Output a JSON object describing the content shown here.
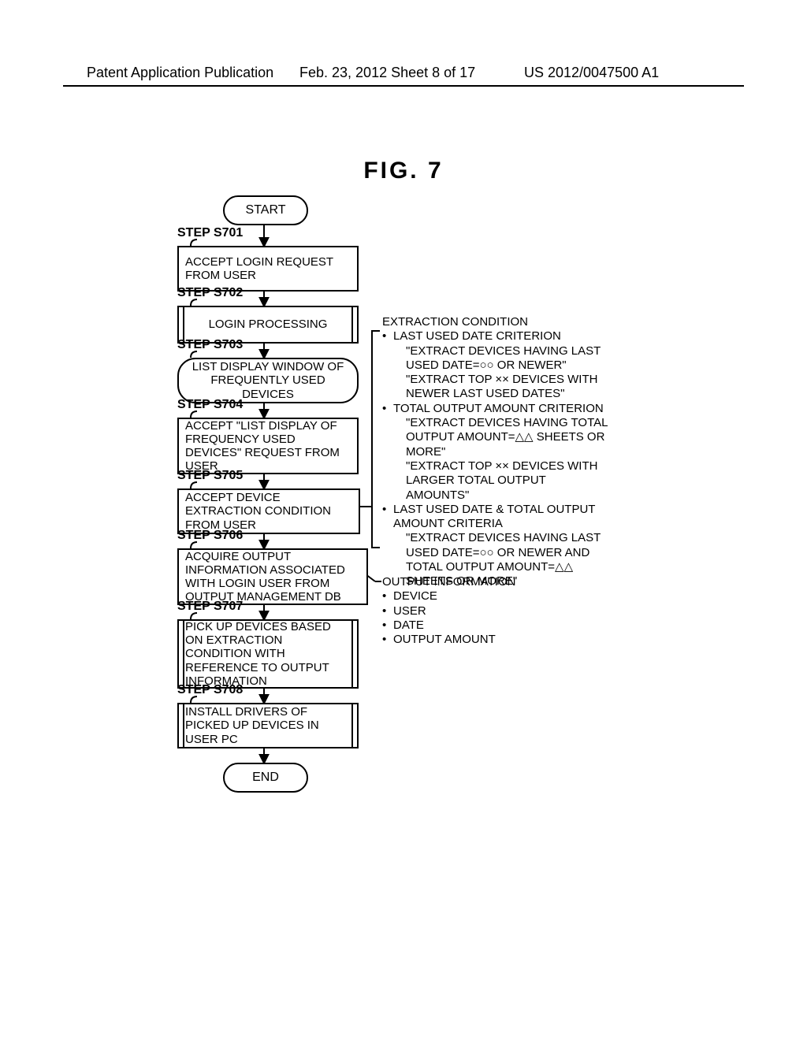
{
  "header": {
    "left": "Patent Application Publication",
    "mid": "Feb. 23, 2012  Sheet 8 of 17",
    "right": "US 2012/0047500 A1"
  },
  "figure_title": "FIG. 7",
  "flow": {
    "start": "START",
    "end": "END",
    "steps": {
      "s701": {
        "label": "STEP S701",
        "text": "ACCEPT LOGIN REQUEST FROM USER"
      },
      "s702": {
        "label": "STEP S702",
        "text": "LOGIN PROCESSING"
      },
      "s703": {
        "label": "STEP S703",
        "text": "LIST DISPLAY WINDOW OF FREQUENTLY USED DEVICES"
      },
      "s704": {
        "label": "STEP S704",
        "text": "ACCEPT \"LIST DISPLAY OF FREQUENCY USED DEVICES\" REQUEST FROM USER"
      },
      "s705": {
        "label": "STEP S705",
        "text": "ACCEPT DEVICE EXTRACTION CONDITION FROM USER"
      },
      "s706": {
        "label": "STEP S706",
        "text": "ACQUIRE OUTPUT INFORMATION ASSOCIATED WITH LOGIN USER FROM OUTPUT MANAGEMENT DB"
      },
      "s707": {
        "label": "STEP S707",
        "text": "PICK UP DEVICES BASED ON EXTRACTION CONDITION WITH REFERENCE TO OUTPUT INFORMATION"
      },
      "s708": {
        "label": "STEP S708",
        "text": "INSTALL DRIVERS OF PICKED UP DEVICES IN USER PC"
      }
    }
  },
  "annot1": {
    "title": "EXTRACTION CONDITION",
    "g1_h": "LAST USED DATE CRITERION",
    "g1_a": "\"EXTRACT DEVICES HAVING LAST USED DATE=○○ OR NEWER\"",
    "g1_b": "\"EXTRACT TOP ×× DEVICES WITH NEWER LAST USED DATES\"",
    "g2_h": "TOTAL OUTPUT AMOUNT CRITERION",
    "g2_a": "\"EXTRACT DEVICES HAVING TOTAL OUTPUT AMOUNT=△△ SHEETS OR MORE\"",
    "g2_b": "\"EXTRACT TOP ×× DEVICES WITH LARGER TOTAL OUTPUT AMOUNTS\"",
    "g3_h": "LAST USED DATE & TOTAL OUTPUT AMOUNT CRITERIA",
    "g3_a": "\"EXTRACT DEVICES HAVING LAST USED DATE=○○ OR NEWER AND TOTAL OUTPUT AMOUNT=△△ SHEETS OR MORE\""
  },
  "annot2": {
    "title": "OUTPUT INFORMATION",
    "i1": "DEVICE",
    "i2": "USER",
    "i3": "DATE",
    "i4": "OUTPUT AMOUNT"
  }
}
